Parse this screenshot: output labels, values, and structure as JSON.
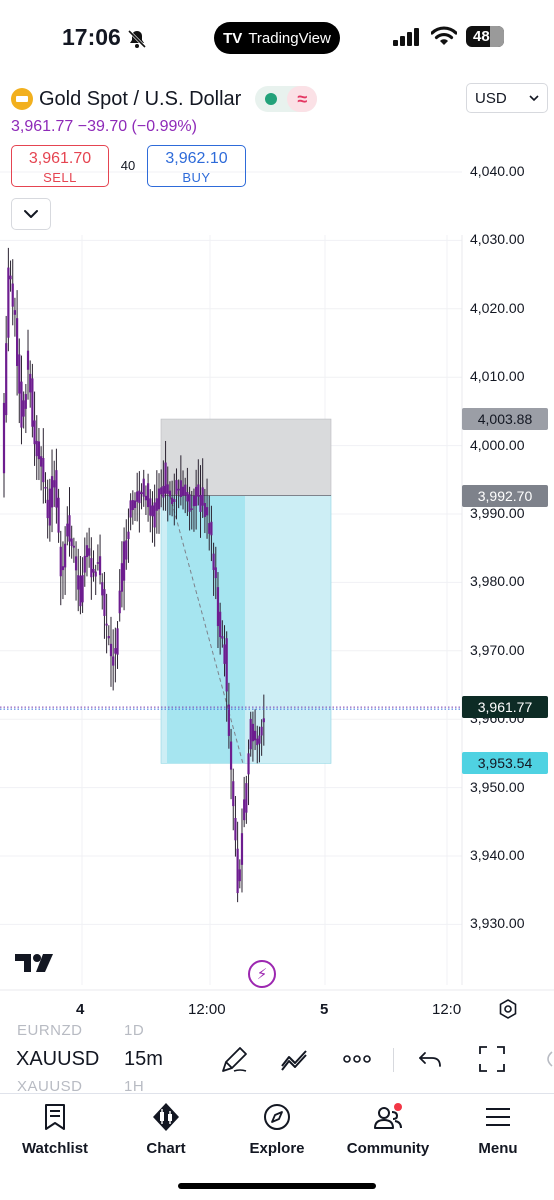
{
  "status_bar": {
    "time": "17:06",
    "app_pill": "TradingView",
    "app_pill_logo": "TV",
    "battery": "48"
  },
  "header": {
    "symbol_name": "Gold Spot / U.S. Dollar",
    "quote": "3,961.77 −39.70 (−0.99%)",
    "sell": {
      "price": "3,961.70",
      "label": "SELL"
    },
    "spread": "40",
    "buy": {
      "price": "3,962.10",
      "label": "BUY"
    },
    "currency": "USD",
    "wave_icon": "≈"
  },
  "chart_data": {
    "type": "candlestick",
    "symbol": "XAUUSD",
    "interval": "15m",
    "ylim": [
      3925,
      4048
    ],
    "y_ticks": [
      "4,040.00",
      "4,030.00",
      "4,020.00",
      "4,010.00",
      "4,000.00",
      "3,990.00",
      "3,980.00",
      "3,970.00",
      "3,960.00",
      "3,950.00",
      "3,940.00",
      "3,930.00"
    ],
    "x_ticks": [
      "4",
      "12:00",
      "5",
      "12:0"
    ],
    "grid": true,
    "candle_color": "#6d1d8f",
    "price_tags": [
      {
        "label": "4,003.88",
        "value": 4003.88,
        "style": "grey1"
      },
      {
        "label": "3,992.70",
        "value": 3992.7,
        "style": "grey2"
      },
      {
        "label": "3,961.77",
        "value": 3961.77,
        "style": "dark"
      },
      {
        "label": "3,953.54",
        "value": 3953.54,
        "style": "cyan"
      }
    ],
    "short_position": {
      "entry": 3992.7,
      "stop": 4003.88,
      "target": 3953.54,
      "stop_color": "#d9dadc",
      "target_color": "#cdeef5",
      "active_color": "#9fe3ee"
    },
    "close_points": [
      3996,
      4026,
      4018,
      4004,
      4012,
      4000,
      3998,
      3990,
      3996,
      3982,
      3988,
      3984,
      3978,
      3984,
      3982,
      3982,
      3972,
      3968,
      3978,
      3988,
      3992,
      3994,
      3994,
      3990,
      3992,
      3996,
      3992,
      3994,
      3992,
      3990,
      3993,
      3990,
      3986,
      3975,
      3970,
      3952,
      3935,
      3948,
      3960,
      3956,
      3962
    ]
  },
  "toolbar": {
    "symbol": "XAUUSD",
    "interval": "15m",
    "ghost_above_symbol": "EURNZD",
    "ghost_above_interval": "1D",
    "ghost_below_symbol": "XAUUSD",
    "ghost_below_interval": "1H"
  },
  "bottom_nav": [
    {
      "label": "Watchlist",
      "icon": "watchlist-icon"
    },
    {
      "label": "Chart",
      "icon": "chart-candles-icon"
    },
    {
      "label": "Explore",
      "icon": "compass-icon"
    },
    {
      "label": "Community",
      "icon": "community-icon"
    },
    {
      "label": "Menu",
      "icon": "hamburger-icon"
    }
  ]
}
